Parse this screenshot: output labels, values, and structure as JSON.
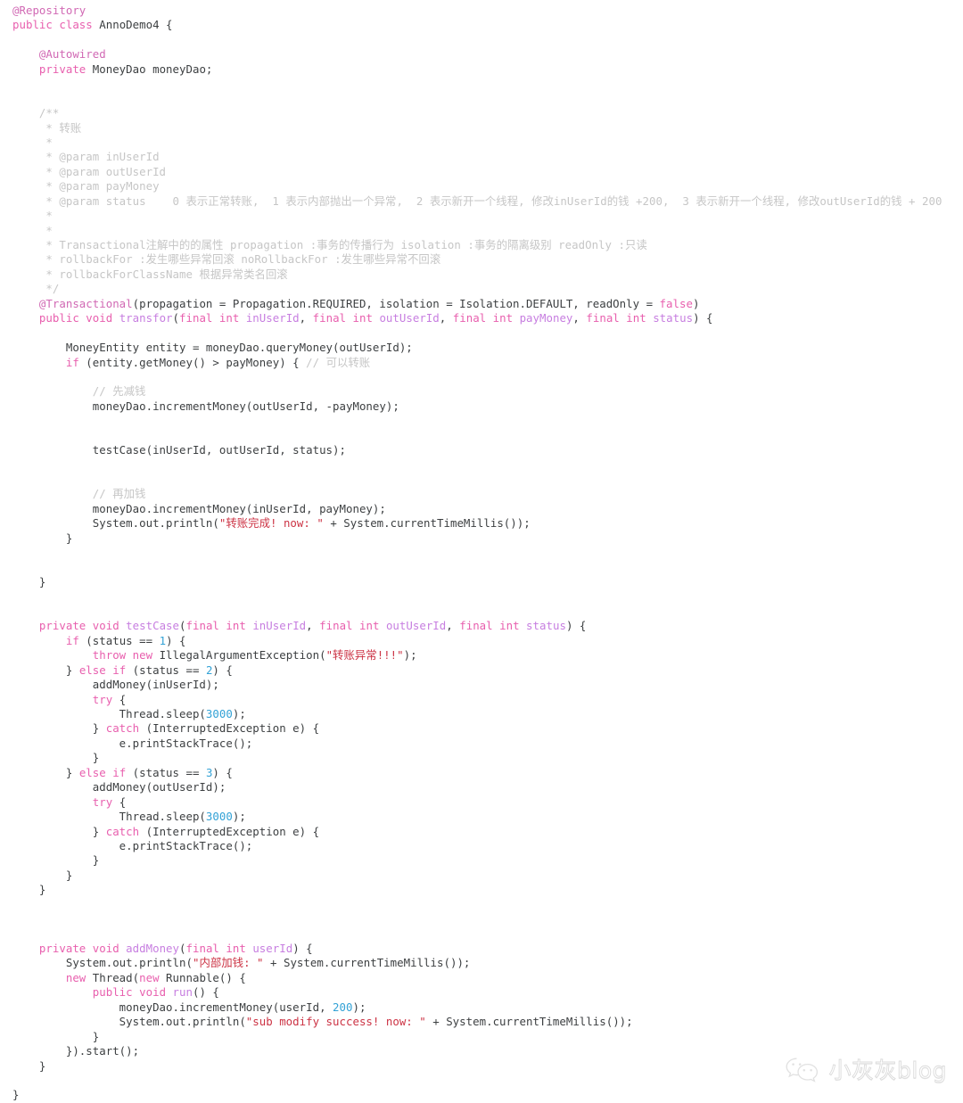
{
  "document": {
    "kind": "source-code-listing",
    "language": "Java",
    "class_name": "AnnoDemo4",
    "background_color": "#ffffff"
  },
  "theme": {
    "plain": "#3c3f41",
    "keyword": "#e85fae",
    "annotation": "#d169b4",
    "parameter": "#c77ee0",
    "comment": "#c6c6c6",
    "string": "#cc3344",
    "number": "#33a2d6"
  },
  "watermark": {
    "icon": "wechat-logo-icon",
    "text": "小灰灰blog"
  },
  "code": {
    "lines": [
      [
        {
          "t": "annot",
          "v": "@Repository"
        }
      ],
      [
        {
          "t": "keyword",
          "v": "public class "
        },
        {
          "t": "type",
          "v": "AnnoDemo4 {"
        }
      ],
      [],
      [
        {
          "t": "plain",
          "v": "    "
        },
        {
          "t": "annot",
          "v": "@Autowired"
        }
      ],
      [
        {
          "t": "plain",
          "v": "    "
        },
        {
          "t": "keyword",
          "v": "private "
        },
        {
          "t": "type",
          "v": "MoneyDao moneyDao;"
        }
      ],
      [],
      [],
      [
        {
          "t": "comment",
          "v": "    /**"
        }
      ],
      [
        {
          "t": "comment",
          "v": "     * 转账"
        }
      ],
      [
        {
          "t": "comment",
          "v": "     *"
        }
      ],
      [
        {
          "t": "comment",
          "v": "     * @param inUserId"
        }
      ],
      [
        {
          "t": "comment",
          "v": "     * @param outUserId"
        }
      ],
      [
        {
          "t": "comment",
          "v": "     * @param payMoney"
        }
      ],
      [
        {
          "t": "comment",
          "v": "     * @param status    0 表示正常转账,  1 表示内部抛出一个异常,  2 表示新开一个线程, 修改inUserId的钱 +200,  3 表示新开一个线程, 修改outUserId的钱 + 200"
        }
      ],
      [
        {
          "t": "comment",
          "v": "     *"
        }
      ],
      [
        {
          "t": "comment",
          "v": "     *"
        }
      ],
      [
        {
          "t": "comment",
          "v": "     * Transactional注解中的的属性 propagation :事务的传播行为 isolation :事务的隔离级别 readOnly :只读"
        }
      ],
      [
        {
          "t": "comment",
          "v": "     * rollbackFor :发生哪些异常回滚 noRollbackFor :发生哪些异常不回滚"
        }
      ],
      [
        {
          "t": "comment",
          "v": "     * rollbackForClassName 根据异常类名回滚"
        }
      ],
      [
        {
          "t": "comment",
          "v": "     */"
        }
      ],
      [
        {
          "t": "plain",
          "v": "    "
        },
        {
          "t": "annot",
          "v": "@Transactional"
        },
        {
          "t": "plain",
          "v": "(propagation = Propagation.REQUIRED, isolation = Isolation.DEFAULT, readOnly = "
        },
        {
          "t": "keyword",
          "v": "false"
        },
        {
          "t": "plain",
          "v": ")"
        }
      ],
      [
        {
          "t": "plain",
          "v": "    "
        },
        {
          "t": "keyword",
          "v": "public void "
        },
        {
          "t": "param",
          "v": "transfor"
        },
        {
          "t": "plain",
          "v": "("
        },
        {
          "t": "keyword",
          "v": "final int "
        },
        {
          "t": "param",
          "v": "inUserId"
        },
        {
          "t": "plain",
          "v": ", "
        },
        {
          "t": "keyword",
          "v": "final int "
        },
        {
          "t": "param",
          "v": "outUserId"
        },
        {
          "t": "plain",
          "v": ", "
        },
        {
          "t": "keyword",
          "v": "final int "
        },
        {
          "t": "param",
          "v": "payMoney"
        },
        {
          "t": "plain",
          "v": ", "
        },
        {
          "t": "keyword",
          "v": "final int "
        },
        {
          "t": "param",
          "v": "status"
        },
        {
          "t": "plain",
          "v": ") {"
        }
      ],
      [],
      [
        {
          "t": "plain",
          "v": "        MoneyEntity entity = moneyDao.queryMoney(outUserId);"
        }
      ],
      [
        {
          "t": "plain",
          "v": "        "
        },
        {
          "t": "keyword",
          "v": "if"
        },
        {
          "t": "plain",
          "v": " (entity.getMoney() > payMoney) { "
        },
        {
          "t": "comment",
          "v": "// 可以转账"
        }
      ],
      [],
      [
        {
          "t": "plain",
          "v": "            "
        },
        {
          "t": "comment",
          "v": "// 先减钱"
        }
      ],
      [
        {
          "t": "plain",
          "v": "            moneyDao.incrementMoney(outUserId, -payMoney);"
        }
      ],
      [],
      [],
      [
        {
          "t": "plain",
          "v": "            testCase(inUserId, outUserId, status);"
        }
      ],
      [],
      [],
      [
        {
          "t": "plain",
          "v": "            "
        },
        {
          "t": "comment",
          "v": "// 再加钱"
        }
      ],
      [
        {
          "t": "plain",
          "v": "            moneyDao.incrementMoney(inUserId, payMoney);"
        }
      ],
      [
        {
          "t": "plain",
          "v": "            System.out.println("
        },
        {
          "t": "string",
          "v": "\"转账完成! now: \""
        },
        {
          "t": "plain",
          "v": " + System.currentTimeMillis());"
        }
      ],
      [
        {
          "t": "plain",
          "v": "        }"
        }
      ],
      [],
      [],
      [
        {
          "t": "plain",
          "v": "    }"
        }
      ],
      [],
      [],
      [
        {
          "t": "plain",
          "v": "    "
        },
        {
          "t": "keyword",
          "v": "private void "
        },
        {
          "t": "param",
          "v": "testCase"
        },
        {
          "t": "plain",
          "v": "("
        },
        {
          "t": "keyword",
          "v": "final int "
        },
        {
          "t": "param",
          "v": "inUserId"
        },
        {
          "t": "plain",
          "v": ", "
        },
        {
          "t": "keyword",
          "v": "final int "
        },
        {
          "t": "param",
          "v": "outUserId"
        },
        {
          "t": "plain",
          "v": ", "
        },
        {
          "t": "keyword",
          "v": "final int "
        },
        {
          "t": "param",
          "v": "status"
        },
        {
          "t": "plain",
          "v": ") {"
        }
      ],
      [
        {
          "t": "plain",
          "v": "        "
        },
        {
          "t": "keyword",
          "v": "if"
        },
        {
          "t": "plain",
          "v": " (status == "
        },
        {
          "t": "number",
          "v": "1"
        },
        {
          "t": "plain",
          "v": ") {"
        }
      ],
      [
        {
          "t": "plain",
          "v": "            "
        },
        {
          "t": "keyword",
          "v": "throw new "
        },
        {
          "t": "plain",
          "v": "IllegalArgumentException("
        },
        {
          "t": "string",
          "v": "\"转账异常!!!\""
        },
        {
          "t": "plain",
          "v": ");"
        }
      ],
      [
        {
          "t": "plain",
          "v": "        } "
        },
        {
          "t": "keyword",
          "v": "else if"
        },
        {
          "t": "plain",
          "v": " (status == "
        },
        {
          "t": "number",
          "v": "2"
        },
        {
          "t": "plain",
          "v": ") {"
        }
      ],
      [
        {
          "t": "plain",
          "v": "            addMoney(inUserId);"
        }
      ],
      [
        {
          "t": "plain",
          "v": "            "
        },
        {
          "t": "keyword",
          "v": "try"
        },
        {
          "t": "plain",
          "v": " {"
        }
      ],
      [
        {
          "t": "plain",
          "v": "                Thread.sleep("
        },
        {
          "t": "number",
          "v": "3000"
        },
        {
          "t": "plain",
          "v": ");"
        }
      ],
      [
        {
          "t": "plain",
          "v": "            } "
        },
        {
          "t": "keyword",
          "v": "catch"
        },
        {
          "t": "plain",
          "v": " (InterruptedException e) {"
        }
      ],
      [
        {
          "t": "plain",
          "v": "                e.printStackTrace();"
        }
      ],
      [
        {
          "t": "plain",
          "v": "            }"
        }
      ],
      [
        {
          "t": "plain",
          "v": "        } "
        },
        {
          "t": "keyword",
          "v": "else if"
        },
        {
          "t": "plain",
          "v": " (status == "
        },
        {
          "t": "number",
          "v": "3"
        },
        {
          "t": "plain",
          "v": ") {"
        }
      ],
      [
        {
          "t": "plain",
          "v": "            addMoney(outUserId);"
        }
      ],
      [
        {
          "t": "plain",
          "v": "            "
        },
        {
          "t": "keyword",
          "v": "try"
        },
        {
          "t": "plain",
          "v": " {"
        }
      ],
      [
        {
          "t": "plain",
          "v": "                Thread.sleep("
        },
        {
          "t": "number",
          "v": "3000"
        },
        {
          "t": "plain",
          "v": ");"
        }
      ],
      [
        {
          "t": "plain",
          "v": "            } "
        },
        {
          "t": "keyword",
          "v": "catch"
        },
        {
          "t": "plain",
          "v": " (InterruptedException e) {"
        }
      ],
      [
        {
          "t": "plain",
          "v": "                e.printStackTrace();"
        }
      ],
      [
        {
          "t": "plain",
          "v": "            }"
        }
      ],
      [
        {
          "t": "plain",
          "v": "        }"
        }
      ],
      [
        {
          "t": "plain",
          "v": "    }"
        }
      ],
      [],
      [],
      [],
      [
        {
          "t": "plain",
          "v": "    "
        },
        {
          "t": "keyword",
          "v": "private void "
        },
        {
          "t": "param",
          "v": "addMoney"
        },
        {
          "t": "plain",
          "v": "("
        },
        {
          "t": "keyword",
          "v": "final int "
        },
        {
          "t": "param",
          "v": "userId"
        },
        {
          "t": "plain",
          "v": ") {"
        }
      ],
      [
        {
          "t": "plain",
          "v": "        System.out.println("
        },
        {
          "t": "string",
          "v": "\"内部加钱: \""
        },
        {
          "t": "plain",
          "v": " + System.currentTimeMillis());"
        }
      ],
      [
        {
          "t": "plain",
          "v": "        "
        },
        {
          "t": "keyword",
          "v": "new "
        },
        {
          "t": "plain",
          "v": "Thread("
        },
        {
          "t": "keyword",
          "v": "new "
        },
        {
          "t": "plain",
          "v": "Runnable() {"
        }
      ],
      [
        {
          "t": "plain",
          "v": "            "
        },
        {
          "t": "keyword",
          "v": "public void "
        },
        {
          "t": "param",
          "v": "run"
        },
        {
          "t": "plain",
          "v": "() {"
        }
      ],
      [
        {
          "t": "plain",
          "v": "                moneyDao.incrementMoney(userId, "
        },
        {
          "t": "number",
          "v": "200"
        },
        {
          "t": "plain",
          "v": ");"
        }
      ],
      [
        {
          "t": "plain",
          "v": "                System.out.println("
        },
        {
          "t": "string",
          "v": "\"sub modify success! now: \""
        },
        {
          "t": "plain",
          "v": " + System.currentTimeMillis());"
        }
      ],
      [
        {
          "t": "plain",
          "v": "            }"
        }
      ],
      [
        {
          "t": "plain",
          "v": "        }).start();"
        }
      ],
      [
        {
          "t": "plain",
          "v": "    }"
        }
      ],
      [],
      [
        {
          "t": "plain",
          "v": "}"
        }
      ]
    ]
  }
}
